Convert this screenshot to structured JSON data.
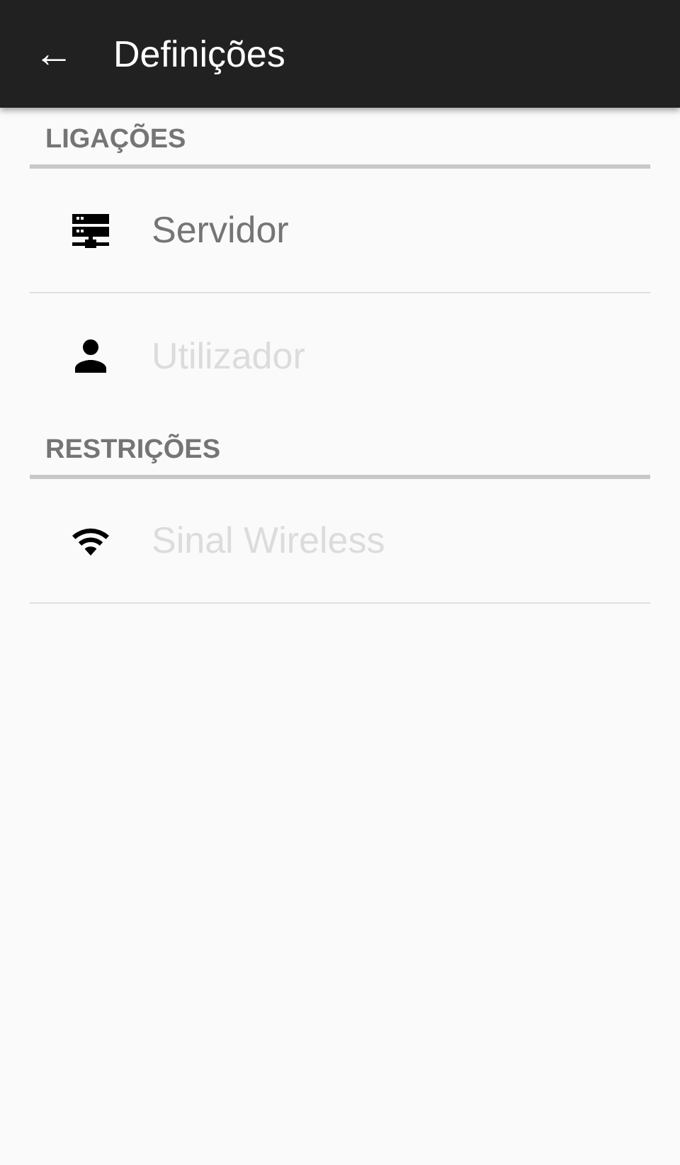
{
  "toolbar": {
    "back_icon": "←",
    "title": "Definições"
  },
  "sections": [
    {
      "header": "LIGAÇÕES",
      "items": [
        {
          "label": "Servidor",
          "disabled": false
        },
        {
          "label": "Utilizador",
          "disabled": true
        }
      ]
    },
    {
      "header": "RESTRIÇÕES",
      "items": [
        {
          "label": "Sinal Wireless",
          "disabled": true
        }
      ]
    }
  ]
}
